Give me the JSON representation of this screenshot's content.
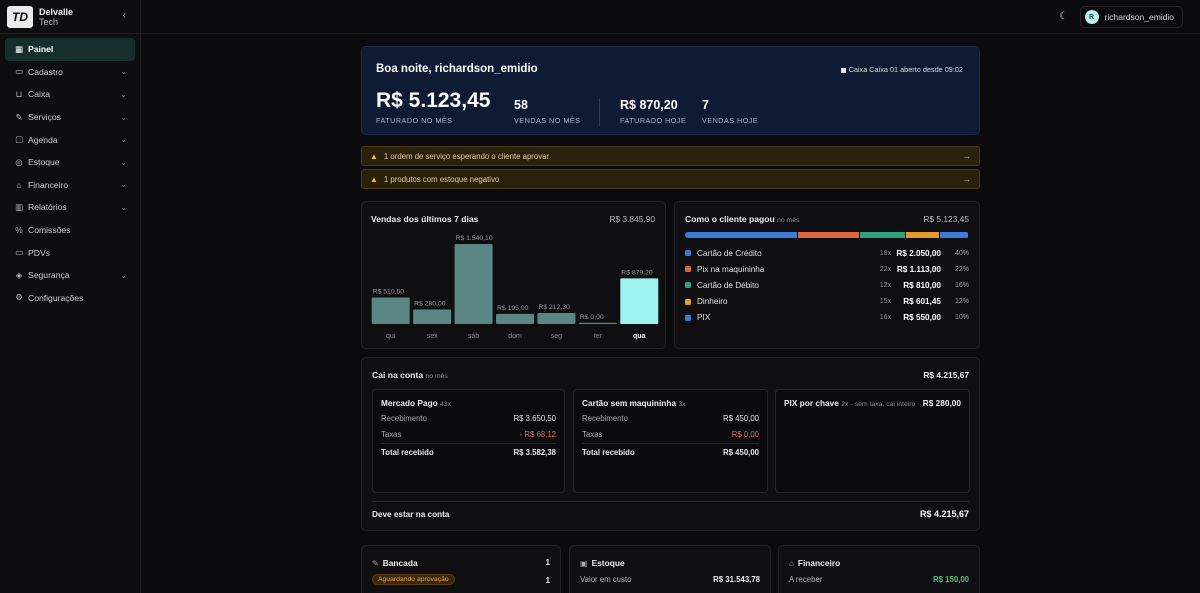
{
  "brand": {
    "line1": "Delvalle",
    "line2": "Tech",
    "logo_text": "TD"
  },
  "sidebar": {
    "items": [
      {
        "label": "Painel",
        "icon": "grid-icon",
        "glyph": "▦",
        "active": true,
        "has_chevron": false
      },
      {
        "label": "Cadastro",
        "icon": "folder-icon",
        "glyph": "▭",
        "active": false,
        "has_chevron": true
      },
      {
        "label": "Caixa",
        "icon": "cart-icon",
        "glyph": "⊔",
        "active": false,
        "has_chevron": true
      },
      {
        "label": "Serviços",
        "icon": "wrench-icon",
        "glyph": "✎",
        "active": false,
        "has_chevron": true
      },
      {
        "label": "Agenda",
        "icon": "calendar-icon",
        "glyph": "▢",
        "active": false,
        "has_chevron": true
      },
      {
        "label": "Estoque",
        "icon": "box-icon",
        "glyph": "◎",
        "active": false,
        "has_chevron": true
      },
      {
        "label": "Financeiro",
        "icon": "bank-icon",
        "glyph": "⌂",
        "active": false,
        "has_chevron": true
      },
      {
        "label": "Relatórios",
        "icon": "chart-icon",
        "glyph": "▥",
        "active": false,
        "has_chevron": true
      },
      {
        "label": "Comissões",
        "icon": "percent-icon",
        "glyph": "%",
        "active": false,
        "has_chevron": false
      },
      {
        "label": "PDVs",
        "icon": "monitor-icon",
        "glyph": "▭",
        "active": false,
        "has_chevron": false
      },
      {
        "label": "Segurança",
        "icon": "shield-icon",
        "glyph": "◈",
        "active": false,
        "has_chevron": true
      },
      {
        "label": "Configurações",
        "icon": "gear-icon",
        "glyph": "⚙",
        "active": false,
        "has_chevron": false
      }
    ]
  },
  "topbar": {
    "user_initial": "R",
    "user_name": "richardson_emidio"
  },
  "hero": {
    "greeting": "Boa noite, richardson_emidio",
    "caixa_status": "Caixa Caixa 01 aberto desde 09:02",
    "faturado_mes": "R$ 5.123,45",
    "faturado_mes_label": "FATURADO NO MÊS",
    "vendas_mes": "58",
    "vendas_mes_label": "VENDAS NO MÊS",
    "faturado_hoje": "R$ 870,20",
    "faturado_hoje_label": "FATURADO HOJE",
    "vendas_hoje": "7",
    "vendas_hoje_label": "VENDAS HOJE"
  },
  "alerts": [
    {
      "text": "1 ordem de serviço esperando o cliente aprovar"
    },
    {
      "text": "1 produtos com estoque negativo"
    }
  ],
  "sales7": {
    "title": "Vendas dos últimos 7 dias",
    "total": "R$ 3.845,90"
  },
  "chart_data": {
    "type": "bar",
    "title": "Vendas dos últimos 7 dias",
    "categories": [
      "qui",
      "sex",
      "sáb",
      "dom",
      "seg",
      "ter",
      "qua"
    ],
    "values": [
      510.5,
      280.0,
      1540.1,
      195.0,
      212.3,
      0.0,
      879.2
    ],
    "value_labels": [
      "R$ 510,50",
      "R$ 280,00",
      "R$ 1.540,10",
      "R$ 195,00",
      "R$ 212,30",
      "R$ 0,00",
      "R$ 879,20"
    ],
    "highlight_index": 6,
    "ylim": [
      0,
      1540.1
    ],
    "colors": {
      "bar": "#5a8783",
      "highlight": "#9ef2f0"
    }
  },
  "payments": {
    "title": "Como o cliente pagou",
    "period": "no mês",
    "total": "R$ 5.123,45",
    "methods": [
      {
        "name": "Cartão de Crédito",
        "count": "18x",
        "amount": "R$ 2.050,00",
        "pct": "40%",
        "share": 40,
        "color": "#3e7bd6"
      },
      {
        "name": "Pix na maquininha",
        "count": "22x",
        "amount": "R$ 1.113,00",
        "pct": "22%",
        "share": 22,
        "color": "#e0663f"
      },
      {
        "name": "Cartão de Débito",
        "count": "12x",
        "amount": "R$ 810,00",
        "pct": "16%",
        "share": 16,
        "color": "#2fa37c"
      },
      {
        "name": "Dinheiro",
        "count": "15x",
        "amount": "R$ 601,45",
        "pct": "12%",
        "share": 12,
        "color": "#e39b2f"
      },
      {
        "name": "PIX",
        "count": "16x",
        "amount": "R$ 550,00",
        "pct": "10%",
        "share": 10,
        "color": "#3e7bd6"
      }
    ]
  },
  "conta": {
    "title": "Cai na conta",
    "period": "no mês",
    "total": "R$ 4.215,67",
    "mp": {
      "title": "Mercado Pago",
      "count": "43x",
      "rec_label": "Recebimento",
      "rec": "R$ 3.650,50",
      "tax_label": "Taxas",
      "tax": "- R$ 68,12",
      "tot_label": "Total recebido",
      "tot": "R$ 3.582,38"
    },
    "csm": {
      "title": "Cartão sem maquininha",
      "count": "3x",
      "rec_label": "Recebimento",
      "rec": "R$ 450,00",
      "tax_label": "Taxas",
      "tax": "R$ 0,00",
      "tot_label": "Total recebido",
      "tot": "R$ 450,00"
    },
    "pix": {
      "title": "PIX por chave",
      "count": "2x",
      "note": "· sem taxa, cai inteiro",
      "value": "R$ 280,00"
    },
    "deve_label": "Deve estar na conta",
    "deve_value": "R$ 4.215,67"
  },
  "bancada": {
    "title": "Bancada",
    "count": "1",
    "badge": "Aguardando aprovação",
    "badge_count": "1"
  },
  "estoque": {
    "title": "Estoque",
    "row_label": "Valor em custo",
    "row_value": "R$ 31.543,78"
  },
  "financeiro": {
    "title": "Financeiro",
    "row_label": "A receber",
    "row_value": "R$ 150,00"
  }
}
